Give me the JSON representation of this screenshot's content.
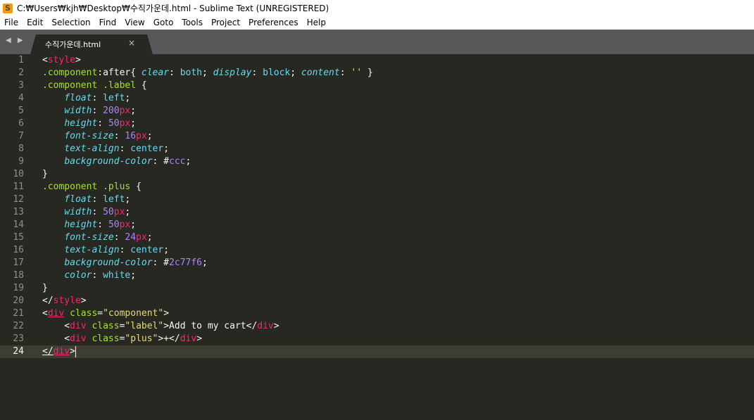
{
  "window": {
    "title": "C:₩Users₩kjh₩Desktop₩수직가운데.html - Sublime Text (UNREGISTERED)",
    "app_icon": "sublime-icon"
  },
  "menu": [
    "File",
    "Edit",
    "Selection",
    "Find",
    "View",
    "Goto",
    "Tools",
    "Project",
    "Preferences",
    "Help"
  ],
  "tabs": [
    {
      "label": "수직가운데.html",
      "close": "×",
      "active": true
    }
  ],
  "nav_arrows": "◀ ▶",
  "editor": {
    "active_line": 24,
    "line_numbers": [
      "1",
      "2",
      "3",
      "4",
      "5",
      "6",
      "7",
      "8",
      "9",
      "10",
      "11",
      "12",
      "13",
      "14",
      "15",
      "16",
      "17",
      "18",
      "19",
      "20",
      "21",
      "22",
      "23",
      "24"
    ],
    "lines": [
      "<style>",
      ".component:after{ clear: both; display: block; content: '' }",
      ".component .label {",
      "    float: left;",
      "    width: 200px;",
      "    height: 50px;",
      "    font-size: 16px;",
      "    text-align: center;",
      "    background-color: #ccc;",
      "}",
      ".component .plus {",
      "    float: left;",
      "    width: 50px;",
      "    height: 50px;",
      "    font-size: 24px;",
      "    text-align: center;",
      "    background-color: #2c77f6;",
      "    color: white;",
      "}",
      "</style>",
      "<div class=\"component\">",
      "    <div class=\"label\">Add to my cart</div>",
      "    <div class=\"plus\">+</div>",
      "</div>"
    ]
  },
  "colors": {
    "background": "#272822",
    "tag": "#f92672",
    "attribute": "#a6e22e",
    "string": "#e6db74",
    "property": "#66d9ef",
    "number": "#ae81ff"
  }
}
